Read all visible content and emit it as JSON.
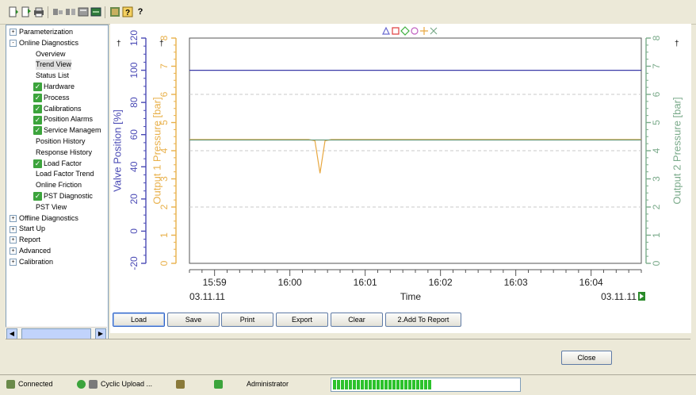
{
  "toolbar": {
    "icons": [
      "new-icon",
      "open-icon",
      "print-icon",
      "connect-icon",
      "disconnect-icon",
      "upload-icon",
      "download-icon",
      "device-icon",
      "help-context-icon"
    ],
    "help_label": "?"
  },
  "tree": {
    "items": [
      {
        "label": "Parameterization",
        "level": 0,
        "expander": "+",
        "check": false
      },
      {
        "label": "Online Diagnostics",
        "level": 0,
        "expander": "-",
        "check": false
      },
      {
        "label": "Overview",
        "level": 1,
        "check": false
      },
      {
        "label": "Trend View",
        "level": 1,
        "check": false,
        "selected": true
      },
      {
        "label": "Status List",
        "level": 1,
        "check": false
      },
      {
        "label": "Hardware",
        "level": 1,
        "check": true
      },
      {
        "label": "Process",
        "level": 1,
        "check": true
      },
      {
        "label": "Calibrations",
        "level": 1,
        "check": true
      },
      {
        "label": "Position Alarms",
        "level": 1,
        "check": true
      },
      {
        "label": "Service Managem",
        "level": 1,
        "check": true
      },
      {
        "label": "Position History",
        "level": 1,
        "check": false
      },
      {
        "label": "Response History",
        "level": 1,
        "check": false
      },
      {
        "label": "Load Factor",
        "level": 1,
        "check": true
      },
      {
        "label": "Load Factor Trend",
        "level": 1,
        "check": false
      },
      {
        "label": "Online Friction",
        "level": 1,
        "check": false
      },
      {
        "label": "PST Diagnostic",
        "level": 1,
        "check": true
      },
      {
        "label": "PST View",
        "level": 1,
        "check": false
      },
      {
        "label": "Offline Diagnostics",
        "level": 0,
        "expander": "+",
        "check": false
      },
      {
        "label": "Start Up",
        "level": 0,
        "expander": "+",
        "check": false
      },
      {
        "label": "Report",
        "level": 0,
        "expander": "+",
        "check": false
      },
      {
        "label": "Advanced",
        "level": 0,
        "expander": "+",
        "check": false
      },
      {
        "label": "Calibration",
        "level": 0,
        "expander": "+",
        "check": false
      }
    ]
  },
  "chart_data": {
    "type": "line",
    "xlabel": "Time",
    "x_ticks": [
      "15:59",
      "16:00",
      "16:01",
      "16:02",
      "16:03",
      "16:04"
    ],
    "x_range": [
      "15:58:40",
      "16:04:40"
    ],
    "date_left": "03.11.11",
    "date_right": "03.11.11",
    "axes": [
      {
        "label": "Valve Position [%]",
        "color": "#4a4ab5",
        "ylim": [
          -20,
          120
        ],
        "ticks": [
          "-20",
          "0",
          "20",
          "40",
          "60",
          "80",
          "100",
          "120"
        ]
      },
      {
        "label": "Output 1 Pressure [bar]",
        "color": "#e8b04a",
        "ylim": [
          0,
          8
        ],
        "ticks": [
          "0",
          "1",
          "2",
          "3",
          "4",
          "5",
          "6",
          "7",
          "8"
        ]
      },
      {
        "label": "Output 2 Pressure [bar]",
        "color": "#7aaa8a",
        "ylim": [
          0,
          8
        ],
        "ticks": [
          "0",
          "1",
          "2",
          "3",
          "4",
          "5",
          "6",
          "7",
          "8"
        ]
      }
    ],
    "series": [
      {
        "color": "#3a3aa8",
        "axis": 0,
        "points": [
          [
            "15:58:40",
            100
          ],
          [
            "16:04:40",
            100
          ]
        ]
      },
      {
        "color": "#e8a840",
        "axis": 1,
        "points": [
          [
            "15:58:40",
            4.4
          ],
          [
            "16:00:15",
            4.4
          ],
          [
            "16:00:20",
            4.35
          ],
          [
            "16:00:24",
            3.2
          ],
          [
            "16:00:28",
            4.35
          ],
          [
            "16:00:33",
            4.4
          ],
          [
            "16:04:40",
            4.4
          ]
        ]
      },
      {
        "color": "#6a9a7a",
        "axis": 2,
        "points": [
          [
            "15:58:40",
            4.38
          ],
          [
            "16:04:40",
            4.38
          ]
        ]
      }
    ],
    "marker_legend": [
      "triangle",
      "square",
      "diamond",
      "circle",
      "plus",
      "cross"
    ]
  },
  "buttons": {
    "load": "Load",
    "save": "Save",
    "print": "Print",
    "export": "Export",
    "clear": "Clear",
    "add_report": "2.Add To Report",
    "close": "Close"
  },
  "status": {
    "connected": "Connected",
    "cyclic": "Cyclic Upload ...",
    "user": "Administrator",
    "progress": 0.53
  }
}
